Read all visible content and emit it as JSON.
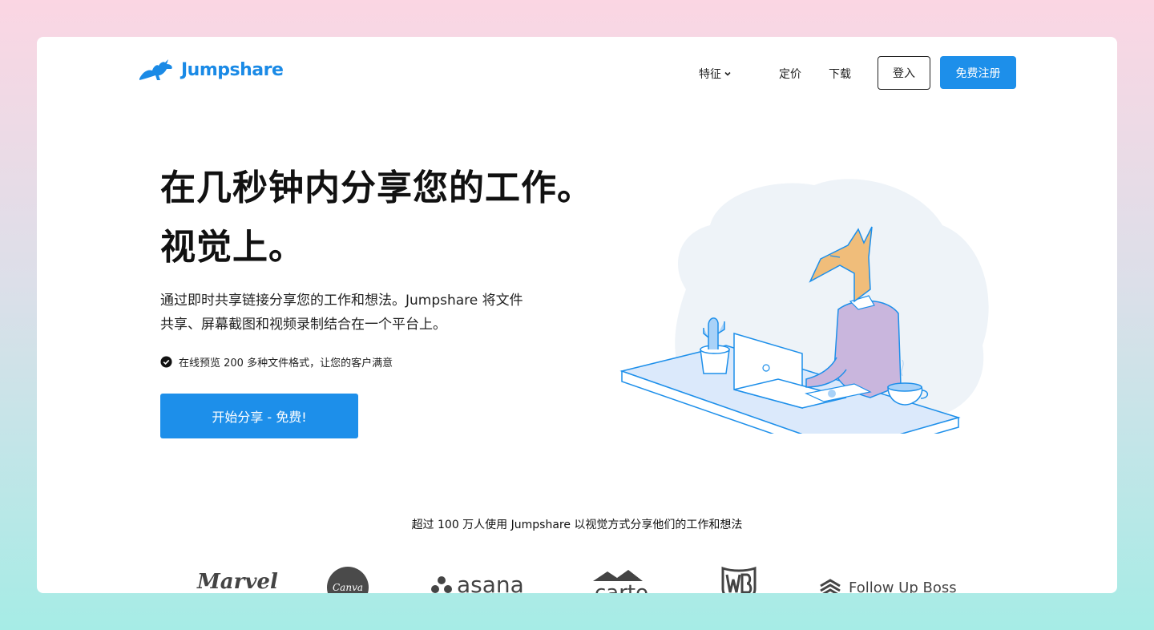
{
  "brand": {
    "name": "Jumpshare",
    "color": "#1a8ae6"
  },
  "nav": {
    "features_label": "特征",
    "pricing_label": "定价",
    "download_label": "下载",
    "login_label": "登入",
    "signup_label": "免费注册"
  },
  "hero": {
    "title_line1": "在几秒钟内分享您的工作。",
    "title_line2": "视觉上。",
    "desc_line1": "通过即时共享链接分享您的工作和想法。Jumpshare 将文件",
    "desc_line2": "共享、屏幕截图和视频录制结合在一个平台上。",
    "feature": "在线预览 200 多种文件格式，让您的客户满意",
    "cta_label": "开始分享 - 免费!"
  },
  "trust": {
    "text": "超过 100 万人使用 Jumpshare 以视觉方式分享他们的工作和想法",
    "logos": [
      {
        "name": "Marvel",
        "text": "Marvel"
      },
      {
        "name": "Canva",
        "text": "Canva"
      },
      {
        "name": "asana",
        "text": "asana"
      },
      {
        "name": "carto",
        "text": "carto"
      },
      {
        "name": "Warner Bros",
        "text": "WB"
      },
      {
        "name": "Follow Up Boss",
        "text": "Follow Up Boss"
      }
    ]
  },
  "colors": {
    "primary": "#1d8fea",
    "bg_top": "#fbd6e3",
    "bg_bottom": "#a6ece6"
  }
}
